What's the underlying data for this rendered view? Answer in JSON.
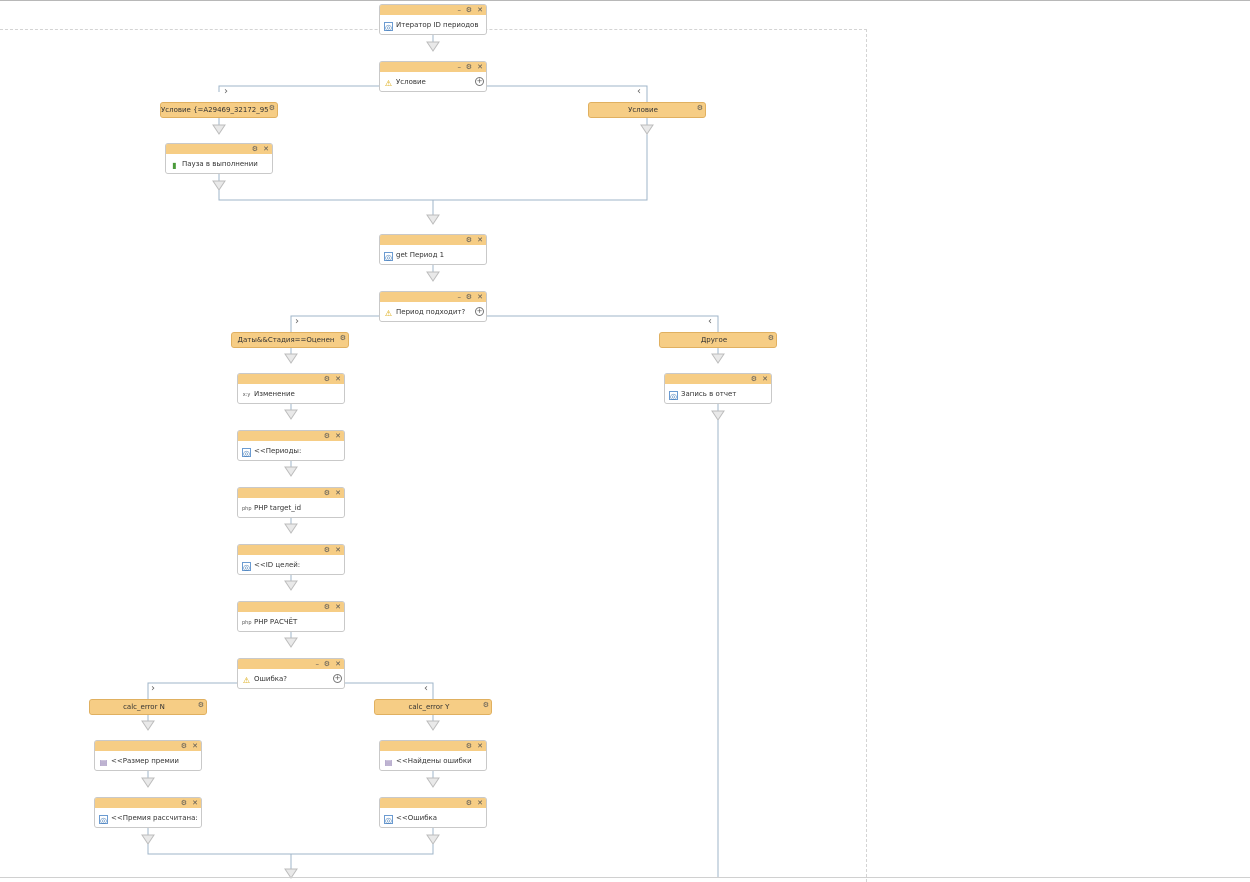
{
  "blocks": [
    {
      "label": "Итератор ID периодов",
      "icon": "iterator-icon",
      "controls": [
        "–",
        "⚙",
        "✕"
      ]
    },
    {
      "label": "Условие",
      "icon": "condition-icon",
      "controls": [
        "–",
        "⚙",
        "✕"
      ],
      "has_add": true
    },
    {
      "label": "Пауза в выполнении",
      "icon": "pause-icon",
      "controls": [
        "⚙",
        "✕"
      ]
    },
    {
      "label": "get Период 1",
      "icon": "get-icon",
      "controls": [
        "⚙",
        "✕"
      ]
    },
    {
      "label": "Период подходит?",
      "icon": "condition-icon",
      "controls": [
        "–",
        "⚙",
        "✕"
      ],
      "has_add": true
    },
    {
      "label": "Изменение",
      "icon": "edit-icon",
      "controls": [
        "⚙",
        "✕"
      ]
    },
    {
      "label": "<<Периоды:",
      "icon": "log-icon",
      "controls": [
        "⚙",
        "✕"
      ]
    },
    {
      "label": "PHP target_id",
      "icon": "php-icon",
      "controls": [
        "⚙",
        "✕"
      ]
    },
    {
      "label": "<<ID целей:",
      "icon": "log-icon",
      "controls": [
        "⚙",
        "✕"
      ]
    },
    {
      "label": "PHP РАСЧЁТ",
      "icon": "php-icon",
      "controls": [
        "⚙",
        "✕"
      ]
    },
    {
      "label": "Ошибка?",
      "icon": "condition-icon",
      "controls": [
        "–",
        "⚙",
        "✕"
      ],
      "has_add": true
    },
    {
      "label": "Запись в отчет",
      "icon": "report-icon",
      "controls": [
        "⚙",
        "✕"
      ]
    },
    {
      "label": "<<Размер премии",
      "icon": "database-icon",
      "controls": [
        "⚙",
        "✕"
      ]
    },
    {
      "label": "<<Премия рассчитана:",
      "icon": "log-icon",
      "controls": [
        "⚙",
        "✕"
      ]
    },
    {
      "label": "<<Найдены ошибки",
      "icon": "database-icon",
      "controls": [
        "⚙",
        "✕"
      ]
    },
    {
      "label": "<<Ошибка",
      "icon": "log-icon",
      "controls": [
        "⚙",
        "✕"
      ]
    }
  ],
  "branches": [
    {
      "label": "Условие {=A29469_32172_95...",
      "icon": "gear-icon"
    },
    {
      "label": "Условие",
      "icon": "gear-icon"
    },
    {
      "label": "Даты&&Стадия==Оценен",
      "icon": "gear-icon"
    },
    {
      "label": "Другое",
      "icon": "gear-icon"
    },
    {
      "label": "calc_error N",
      "icon": "gear-icon"
    },
    {
      "label": "calc_error Y",
      "icon": "gear-icon"
    }
  ],
  "colors": {
    "block_header": "#f6cd85",
    "connector": "#9fb4c8",
    "arrow": "#cfcfcf"
  }
}
